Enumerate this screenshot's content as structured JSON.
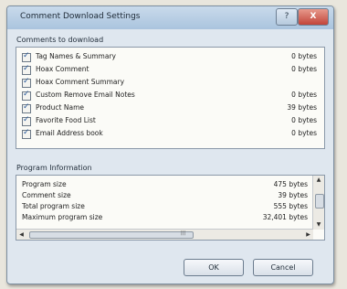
{
  "window": {
    "title": "Comment Download Settings",
    "controls": {
      "help_label": "?",
      "close_label": "X"
    }
  },
  "comments_group": {
    "label": "Comments to download",
    "items": [
      {
        "label": "Tag Names & Summary",
        "size": "0 bytes",
        "checked": true
      },
      {
        "label": "Hoax Comment",
        "size": "0 bytes",
        "checked": true
      },
      {
        "label": "Hoax Comment Summary",
        "size": "",
        "checked": true
      },
      {
        "label": "Custom Remove Email Notes",
        "size": "0 bytes",
        "checked": true
      },
      {
        "label": "Product Name",
        "size": "39 bytes",
        "checked": true
      },
      {
        "label": "Favorite Food List",
        "size": "0 bytes",
        "checked": true
      },
      {
        "label": "Email Address book",
        "size": "0 bytes",
        "checked": true
      }
    ]
  },
  "program_info": {
    "label": "Program Information",
    "rows": [
      {
        "label": "Program size",
        "value": "475 bytes"
      },
      {
        "label": "Comment size",
        "value": "39 bytes"
      },
      {
        "label": "Total program size",
        "value": "555 bytes"
      },
      {
        "label": "Maximum program size",
        "value": "32,401 bytes"
      }
    ]
  },
  "buttons": {
    "ok_label": "OK",
    "cancel_label": "Cancel"
  },
  "scroll_glyphs": {
    "up": "▲",
    "down": "▼",
    "left": "◀",
    "right": "▶",
    "grip": "|||"
  }
}
